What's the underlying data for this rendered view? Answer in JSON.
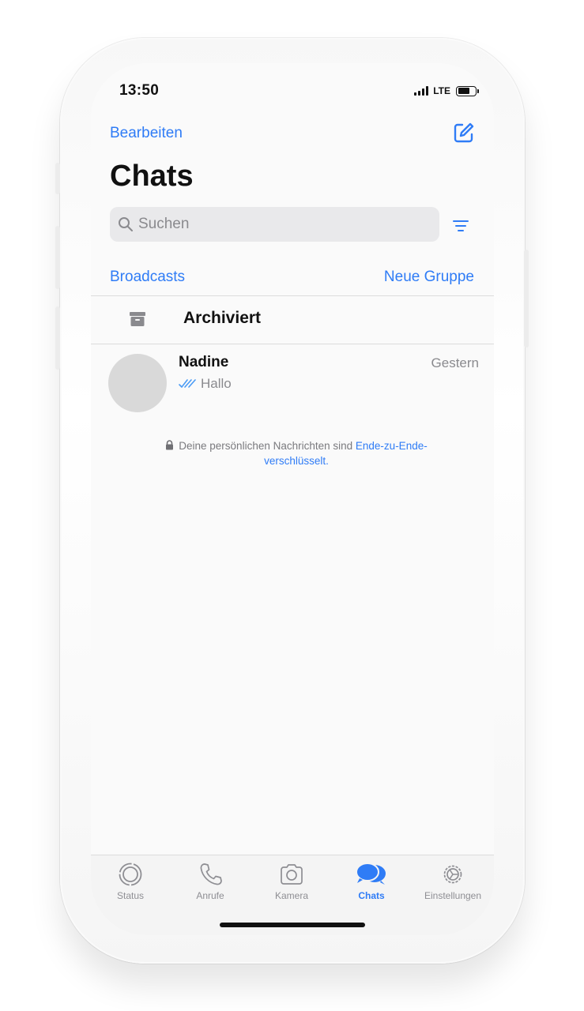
{
  "status_bar": {
    "time": "13:50",
    "network": "LTE",
    "signal_bars": 4,
    "battery_level": 0.7
  },
  "nav": {
    "edit_label": "Bearbeiten",
    "compose_icon": "compose-icon",
    "title": "Chats"
  },
  "search": {
    "placeholder": "Suchen",
    "filter_icon": "filter-icon"
  },
  "actions": {
    "broadcasts_label": "Broadcasts",
    "new_group_label": "Neue Gruppe"
  },
  "archived": {
    "label": "Archiviert",
    "icon": "archive-icon"
  },
  "chats": [
    {
      "name": "Nadine",
      "time": "Gestern",
      "preview": "Hallo",
      "read_receipt": "double-check-icon"
    }
  ],
  "encryption_notice": {
    "text": "Deine persönlichen Nachrichten sind ",
    "link_part1": "Ende-zu-Ende-",
    "link_part2": "verschlüsselt",
    "suffix": "."
  },
  "tabs": [
    {
      "label": "Status",
      "icon": "status-icon",
      "active": false
    },
    {
      "label": "Anrufe",
      "icon": "phone-icon",
      "active": false
    },
    {
      "label": "Kamera",
      "icon": "camera-icon",
      "active": false
    },
    {
      "label": "Chats",
      "icon": "chats-icon",
      "active": true
    },
    {
      "label": "Einstellungen",
      "icon": "settings-icon",
      "active": false
    }
  ],
  "colors": {
    "accent": "#2f7cf6",
    "secondary_text": "#8a8a8e",
    "background": "#fafafa"
  }
}
